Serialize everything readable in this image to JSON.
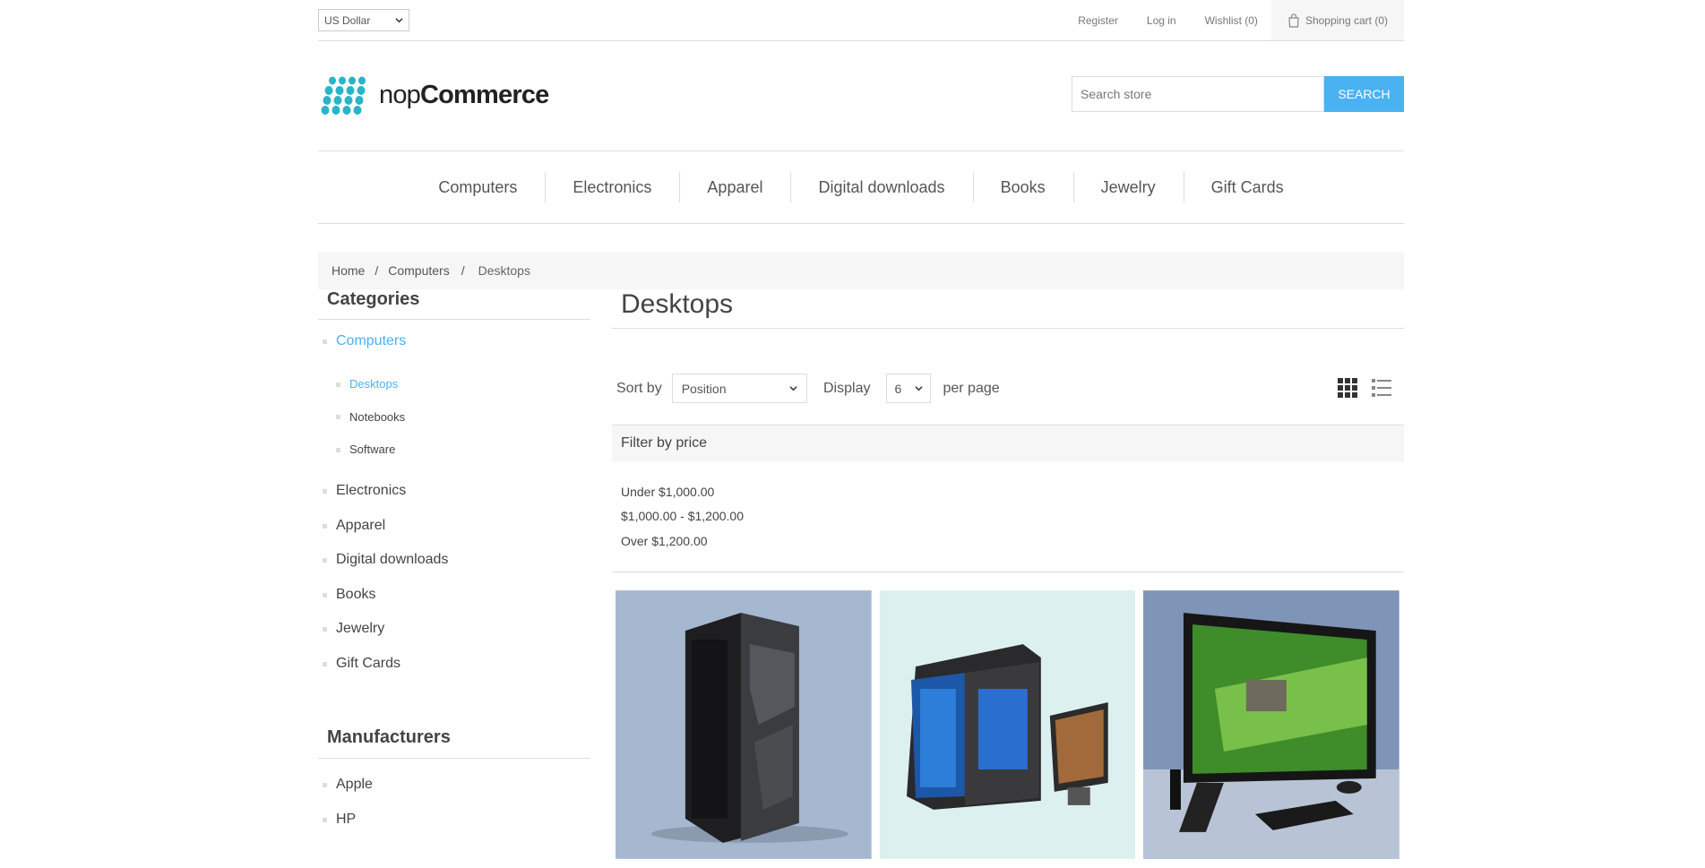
{
  "topbar": {
    "currency": "US Dollar",
    "links": [
      "Register",
      "Log in",
      "Wishlist (0)"
    ],
    "cart": "Shopping cart (0)"
  },
  "header": {
    "logo_light": "nop",
    "logo_bold": "Commerce",
    "search_placeholder": "Search store",
    "search_button": "Search"
  },
  "menu": [
    "Computers",
    "Electronics",
    "Apparel",
    "Digital downloads",
    "Books",
    "Jewelry",
    "Gift Cards"
  ],
  "breadcrumb": [
    "Home",
    "Computers",
    "Desktops"
  ],
  "sidebar": {
    "categories_title": "Categories",
    "categories_top": "Computers",
    "subcategories": [
      "Desktops",
      "Notebooks",
      "Software"
    ],
    "categories_rest": [
      "Electronics",
      "Apparel",
      "Digital downloads",
      "Books",
      "Jewelry",
      "Gift Cards"
    ],
    "manufacturers_title": "Manufacturers",
    "manufacturers": [
      "Apple",
      "HP"
    ]
  },
  "main": {
    "title": "Desktops",
    "sort_label": "Sort by",
    "sort_value": "Position",
    "display_label": "Display",
    "display_value": "6",
    "per_page": "per page",
    "filter_title": "Filter by price",
    "price_ranges": [
      "Under $1,000.00",
      "$1,000.00 - $1,200.00",
      "Over $1,200.00"
    ]
  },
  "colors": {
    "accent": "#4ab2f1",
    "logo_dots": "#2ab4c9"
  }
}
